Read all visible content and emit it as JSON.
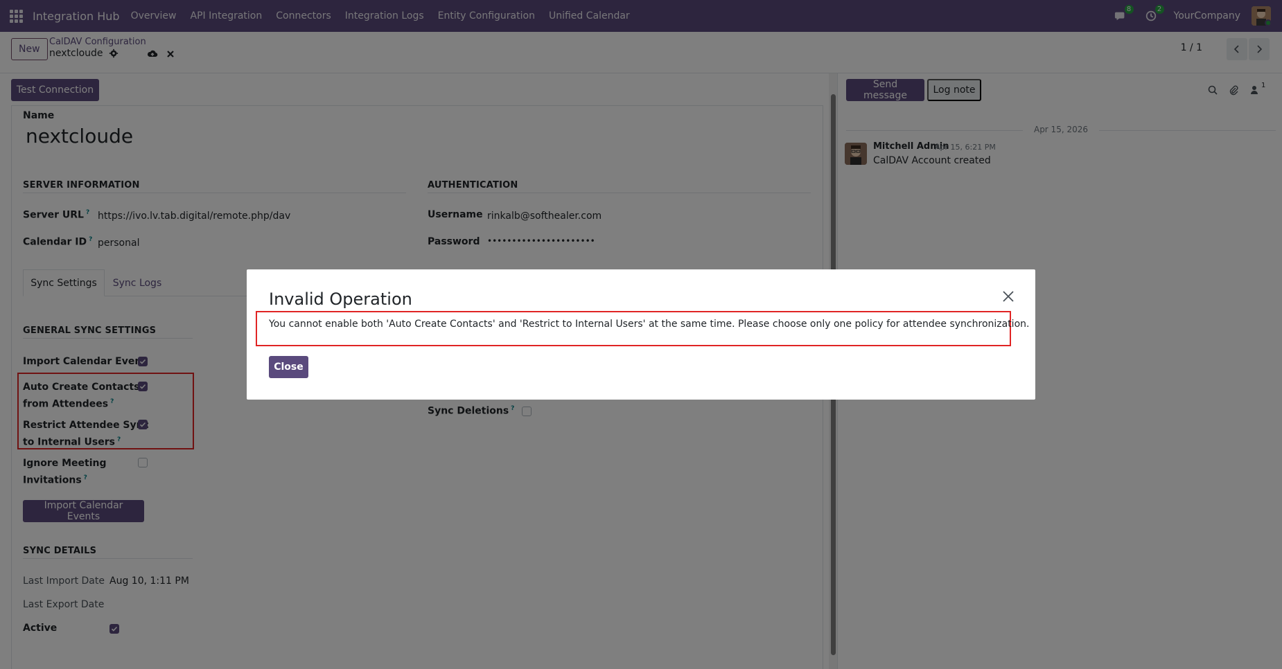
{
  "navbar": {
    "brand": "Integration Hub",
    "menu": [
      "Overview",
      "API Integration",
      "Connectors",
      "Integration Logs",
      "Entity Configuration",
      "Unified Calendar"
    ],
    "messages_badge": "8",
    "activities_badge": "2",
    "company": "YourCompany"
  },
  "control_panel": {
    "new_label": "New",
    "breadcrumb_parent": "CalDAV Configuration",
    "breadcrumb_current": "nextcloude",
    "pager": "1 / 1"
  },
  "form": {
    "test_connection_label": "Test Connection",
    "name_label": "Name",
    "name_value": "nextcloude",
    "server_section": "SERVER INFORMATION",
    "auth_section": "AUTHENTICATION",
    "server_url_label": "Server URL",
    "server_url_value": "https://ivo.lv.tab.digital/remote.php/dav",
    "calendar_id_label": "Calendar ID",
    "calendar_id_value": "personal",
    "username_label": "Username",
    "username_value": "rinkalb@softhealer.com",
    "password_label": "Password",
    "password_value": "••••••••••••••••••••••",
    "help_mark": "?",
    "tabs": [
      "Sync Settings",
      "Sync Logs"
    ],
    "general_section": "GENERAL SYNC SETTINGS",
    "import_calendar_event_label": "Import Calendar Event",
    "import_calendar_event_checked": true,
    "auto_create_label_1": "Auto Create Contacts",
    "auto_create_label_2": "from Attendees",
    "auto_create_checked": true,
    "restrict_label_1": "Restrict Attendee Sync",
    "restrict_label_2": "to Internal Users",
    "restrict_checked": true,
    "ignore_label_1": "Ignore Meeting",
    "ignore_label_2": "Invitations",
    "ignore_checked": false,
    "sync_deletions_label": "Sync Deletions",
    "sync_deletions_checked": false,
    "import_button_label": "Import Calendar Events",
    "sync_details_section": "SYNC DETAILS",
    "last_import_label": "Last Import Date",
    "last_import_value": "Aug 10, 1:11 PM",
    "last_export_label": "Last Export Date",
    "active_label": "Active",
    "active_checked": true
  },
  "chatter": {
    "send_message_label": "Send message",
    "log_note_label": "Log note",
    "followers_count": "1",
    "date_separator": "Apr 15, 2026",
    "message": {
      "author": "Mitchell Admin",
      "date": "Apr 15, 6:21 PM",
      "body": "CalDAV Account created"
    }
  },
  "dialog": {
    "title": "Invalid Operation",
    "body": "You cannot enable both 'Auto Create Contacts' and 'Restrict to Internal Users' at the same time. Please choose only one policy for attendee synchronization.",
    "close_label": "Close"
  },
  "colors": {
    "brand": "#5a4a7d",
    "highlight": "#e02424",
    "badge": "#28a745"
  }
}
